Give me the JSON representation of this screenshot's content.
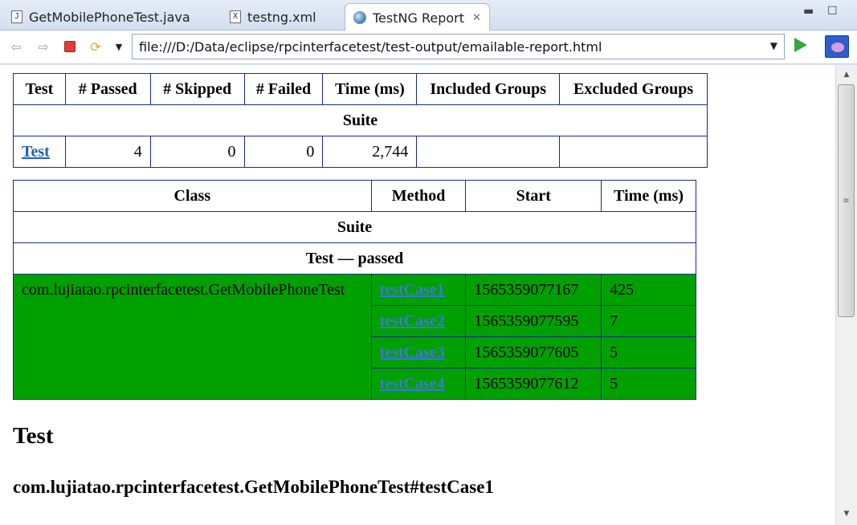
{
  "tabs": [
    {
      "label": "GetMobilePhoneTest.java",
      "icon": "java-file-icon",
      "glyph": "J",
      "active": false
    },
    {
      "label": "testng.xml",
      "icon": "xml-file-icon",
      "glyph": "X",
      "active": false
    },
    {
      "label": "TestNG Report",
      "icon": "globe-icon",
      "active": true
    }
  ],
  "toolbar": {
    "url": "file:///D:/Data/eclipse/rpcinterfacetest/test-output/emailable-report.html"
  },
  "summary_table": {
    "headers": [
      "Test",
      "# Passed",
      "# Skipped",
      "# Failed",
      "Time (ms)",
      "Included Groups",
      "Excluded Groups"
    ],
    "suite_label": "Suite",
    "row": {
      "test": "Test",
      "passed": "4",
      "skipped": "0",
      "failed": "0",
      "time": "2,744",
      "included": "",
      "excluded": ""
    }
  },
  "detail_table": {
    "headers": [
      "Class",
      "Method",
      "Start",
      "Time (ms)"
    ],
    "suite_label": "Suite",
    "group_label": "Test — passed",
    "class_name": "com.lujiatao.rpcinterfacetest.GetMobilePhoneTest",
    "rows": [
      {
        "method": "testCase1",
        "start": "1565359077167",
        "time": "425"
      },
      {
        "method": "testCase2",
        "start": "1565359077595",
        "time": "7"
      },
      {
        "method": "testCase3",
        "start": "1565359077605",
        "time": "5"
      },
      {
        "method": "testCase4",
        "start": "1565359077612",
        "time": "5"
      }
    ]
  },
  "section": {
    "title": "Test",
    "subtitle": "com.lujiatao.rpcinterfacetest.GetMobilePhoneTest#testCase1"
  },
  "colors": {
    "passed_row": "#00a000",
    "table_border": "#1a2a8c",
    "link": "#1f5fb8"
  }
}
